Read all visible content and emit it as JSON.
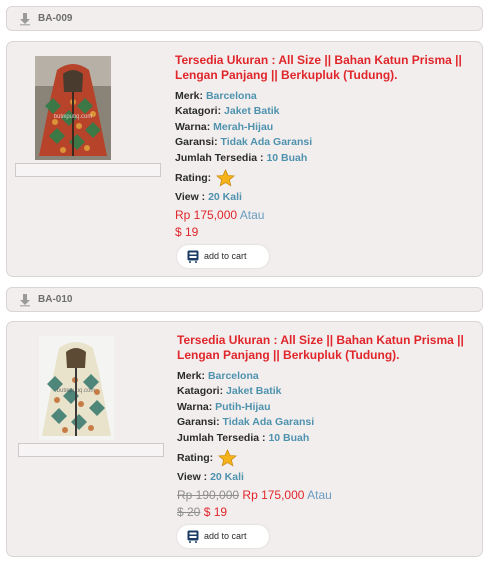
{
  "products": [
    {
      "code": "BA-009",
      "title": "Tersedia Ukuran : All Size || Bahan Katun Prisma || Lengan Panjang || Berkupluk (Tudung).",
      "merk_label": "Merk:",
      "merk": "Barcelona",
      "kategori_label": "Katagori:",
      "kategori": "Jaket Batik",
      "warna_label": "Warna:",
      "warna": "Merah-Hijau",
      "garansi_label": "Garansi:",
      "garansi": "Tidak Ada Garansi",
      "jumlah_label": "Jumlah Tersedia :",
      "jumlah": "10 Buah",
      "rating_label": "Rating:",
      "view_label": "View :",
      "view": "20 Kali",
      "old_price": "",
      "price": "Rp 175,000",
      "atau": "Atau",
      "old_usd": "",
      "usd": "$ 19",
      "cart_label": "add to cart",
      "image_watermark": "butikputiq.com"
    },
    {
      "code": "BA-010",
      "title": "Tersedia Ukuran : All Size || Bahan Katun Prisma || Lengan Panjang || Berkupluk (Tudung).",
      "merk_label": "Merk:",
      "merk": "Barcelona",
      "kategori_label": "Katagori:",
      "kategori": "Jaket Batik",
      "warna_label": "Warna:",
      "warna": "Putih-Hijau",
      "garansi_label": "Garansi:",
      "garansi": "Tidak Ada Garansi",
      "jumlah_label": "Jumlah Tersedia :",
      "jumlah": "10 Buah",
      "rating_label": "Rating:",
      "view_label": "View :",
      "view": "20 Kali",
      "old_price": "Rp 190,000",
      "price": "Rp 175,000",
      "atau": "Atau",
      "old_usd": "$ 20",
      "usd": "$ 19",
      "cart_label": "add to cart",
      "image_watermark": "butikputiq.com"
    }
  ],
  "colors": {
    "accent": "#e0262b",
    "value": "#4e92ae",
    "panel": "#f2eeee"
  },
  "icons": {
    "header": "down-arrow-icon",
    "rating": "star-icon",
    "cart": "cart-icon"
  }
}
